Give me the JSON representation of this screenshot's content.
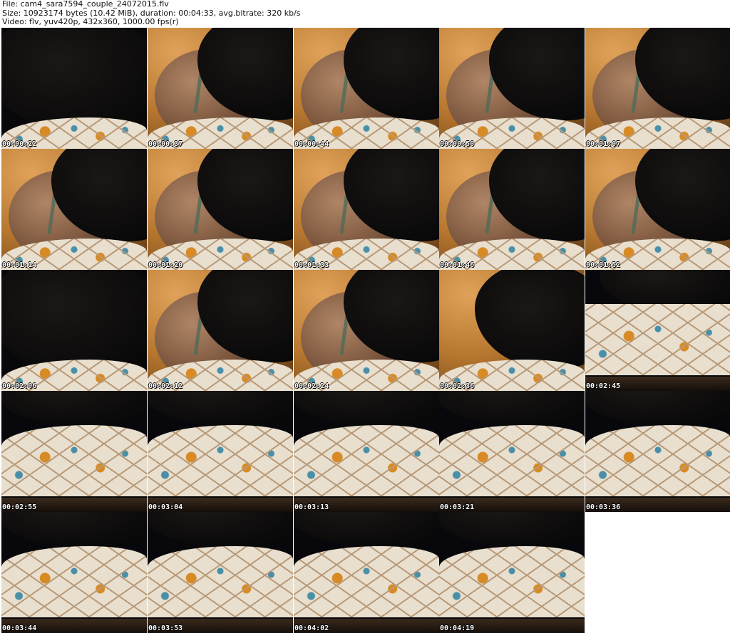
{
  "header": {
    "line1": "File: cam4_sara7594_couple_24072015.flv",
    "line2": "Size: 10923174 bytes (10.42 MiB), duration: 00:04:33, avg.bitrate: 320 kb/s",
    "line3": "Video: flv, yuv420p, 432x360, 1000.00 fps(r)"
  },
  "thumbnails": [
    {
      "time": "00:00:22",
      "scene": "hair"
    },
    {
      "time": "00:00:37",
      "scene": "back"
    },
    {
      "time": "00:00:44",
      "scene": "back"
    },
    {
      "time": "00:00:50",
      "scene": "back"
    },
    {
      "time": "00:01:07",
      "scene": "back"
    },
    {
      "time": "00:01:14",
      "scene": "back"
    },
    {
      "time": "00:01:20",
      "scene": "back"
    },
    {
      "time": "00:01:33",
      "scene": "back"
    },
    {
      "time": "00:01:46",
      "scene": "back"
    },
    {
      "time": "00:01:52",
      "scene": "back"
    },
    {
      "time": "00:02:06",
      "scene": "hair"
    },
    {
      "time": "00:02:12",
      "scene": "back"
    },
    {
      "time": "00:02:24",
      "scene": "back"
    },
    {
      "time": "00:02:36",
      "scene": "hairwall"
    },
    {
      "time": "00:02:45",
      "scene": "blanket"
    },
    {
      "time": "00:02:55",
      "scene": "blanketlow"
    },
    {
      "time": "00:03:04",
      "scene": "blanketlow"
    },
    {
      "time": "00:03:13",
      "scene": "blanketlow"
    },
    {
      "time": "00:03:21",
      "scene": "blanketlow"
    },
    {
      "time": "00:03:36",
      "scene": "blanketlow"
    },
    {
      "time": "00:03:44",
      "scene": "blanketlow"
    },
    {
      "time": "00:03:53",
      "scene": "blanketlow"
    },
    {
      "time": "00:04:02",
      "scene": "blanketlow"
    },
    {
      "time": "00:04:19",
      "scene": "blanketlow"
    }
  ]
}
